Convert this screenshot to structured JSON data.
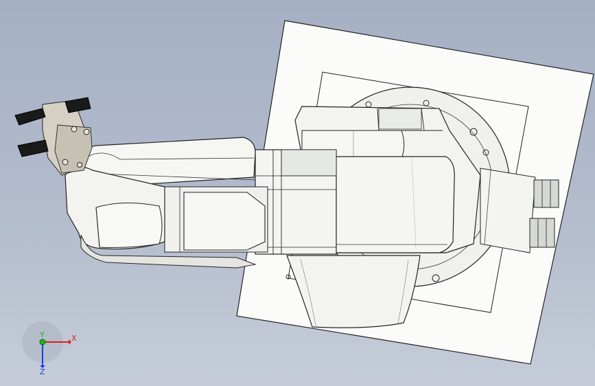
{
  "viewport": {
    "triad": {
      "x_label": "X",
      "y_label": "Y",
      "z_label": "Z"
    }
  },
  "colors": {
    "background_top": "#a5b0c4",
    "background_bottom": "#c6cdd9",
    "part_fill": "#f2f3ef",
    "part_shade": "#e2e4df",
    "edge": "#000000",
    "gripper_finger": "#1a1a1a",
    "gripper_body": "#cfc9bd",
    "axis_x": "#e01a1a",
    "axis_y": "#18b818",
    "axis_z": "#1a3ee0"
  }
}
